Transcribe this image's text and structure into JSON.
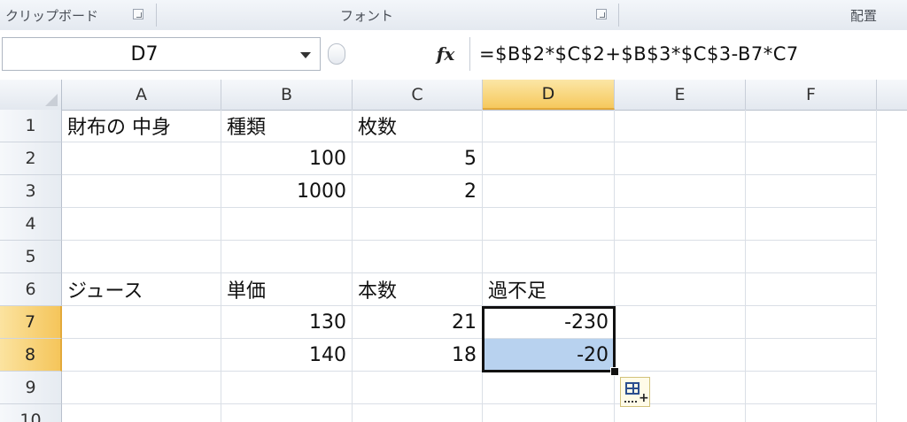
{
  "ribbon": {
    "groups": [
      {
        "label": "クリップボード"
      },
      {
        "label": "フォント"
      },
      {
        "label": "配置"
      }
    ]
  },
  "formula_bar": {
    "name_box": "D7",
    "fx_label": "fx",
    "formula": "=$B$2*$C$2+$B$3*$C$3-B7*C7"
  },
  "sheet": {
    "columns": [
      "A",
      "B",
      "C",
      "D",
      "E",
      "F"
    ],
    "active_column": "D",
    "rows": [
      "1",
      "2",
      "3",
      "4",
      "5",
      "6",
      "7",
      "8",
      "9",
      "10"
    ],
    "active_rows": [
      "7",
      "8"
    ],
    "cells": {
      "A1": "財布の 中身",
      "B1": "種類",
      "C1": "枚数",
      "B2": "100",
      "C2": "5",
      "B3": "1000",
      "C3": "2",
      "A6": "ジュース",
      "B6": "単価",
      "C6": "本数",
      "D6": "過不足",
      "B7": "130",
      "C7": "21",
      "D7": "-230",
      "B8": "140",
      "C8": "18",
      "D8": "-20"
    },
    "selection": "D7:D8"
  }
}
